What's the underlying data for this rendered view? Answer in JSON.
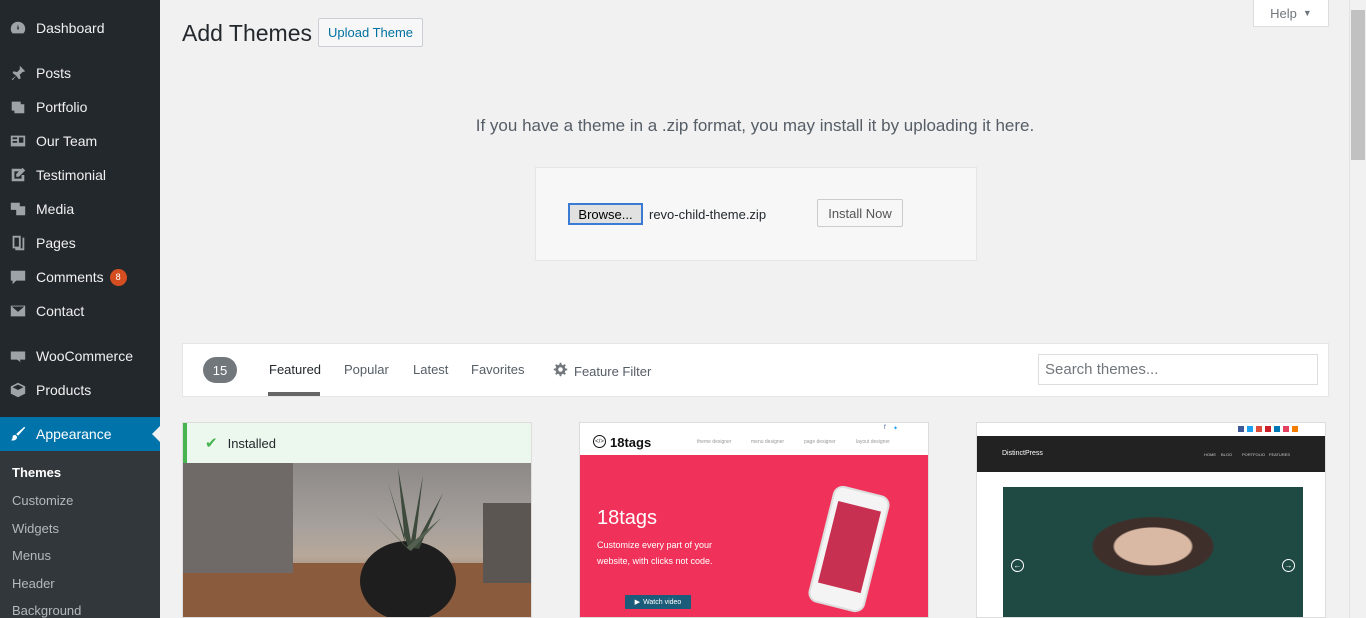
{
  "sidebar": {
    "items": [
      {
        "label": "Dashboard",
        "icon": "dashboard-icon"
      },
      {
        "label": "Posts",
        "icon": "pin-icon"
      },
      {
        "label": "Portfolio",
        "icon": "portfolio-icon"
      },
      {
        "label": "Our Team",
        "icon": "team-icon"
      },
      {
        "label": "Testimonial",
        "icon": "edit-icon"
      },
      {
        "label": "Media",
        "icon": "media-icon"
      },
      {
        "label": "Pages",
        "icon": "pages-icon"
      },
      {
        "label": "Comments",
        "icon": "comments-icon",
        "badge": "8"
      },
      {
        "label": "Contact",
        "icon": "mail-icon"
      },
      {
        "label": "WooCommerce",
        "icon": "woo-icon"
      },
      {
        "label": "Products",
        "icon": "products-icon"
      },
      {
        "label": "Appearance",
        "icon": "brush-icon"
      }
    ],
    "submenu": [
      "Themes",
      "Customize",
      "Widgets",
      "Menus",
      "Header",
      "Background"
    ]
  },
  "header": {
    "title": "Add Themes",
    "upload_button": "Upload Theme",
    "help": "Help"
  },
  "upload": {
    "description": "If you have a theme in a .zip format, you may install it by uploading it here.",
    "browse_label": "Browse...",
    "file_name": "revo-child-theme.zip",
    "install_label": "Install Now"
  },
  "filter": {
    "count": "15",
    "tabs": [
      "Featured",
      "Popular",
      "Latest",
      "Favorites"
    ],
    "feature_filter": "Feature Filter",
    "search_placeholder": "Search themes..."
  },
  "themes": {
    "installed_label": "Installed",
    "card2": {
      "logo": "18tags",
      "nav": [
        "theme designer",
        "menu designer",
        "page designer",
        "layout designer"
      ],
      "hero_title": "18tags",
      "hero_line1": "Customize every part of your",
      "hero_line2": "website, with clicks not code.",
      "watch": "Watch video"
    },
    "card3": {
      "logo": "DistinctPress",
      "nav": [
        "HOME",
        "BLOG",
        "PORTFOLIO",
        "FEATURES"
      ]
    }
  },
  "colors": {
    "sidebar_bg": "#23282d",
    "accent": "#0073aa",
    "badge": "#d54e21",
    "installed": "#46b450",
    "hero_pink": "#f0325a"
  }
}
